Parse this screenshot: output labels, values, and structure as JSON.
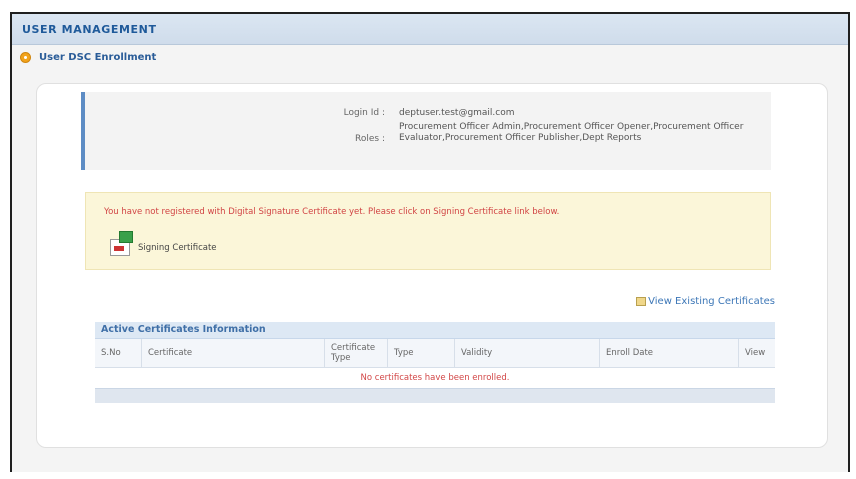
{
  "header": {
    "title": "USER MANAGEMENT"
  },
  "section": {
    "title": "User DSC Enrollment"
  },
  "user_info": {
    "login_label": "Login Id :",
    "login_value": "deptuser.test@gmail.com",
    "roles_label": "Roles :",
    "roles_value": "Procurement Officer Admin,Procurement Officer Opener,Procurement Officer Evaluator,Procurement Officer Publisher,Dept Reports"
  },
  "warning": {
    "message": "You have not registered with Digital Signature Certificate yet. Please click on Signing Certificate link below.",
    "signing_label": "Signing Certificate"
  },
  "view_existing": {
    "label": "View Existing Certificates"
  },
  "certificates_table": {
    "title": "Active Certificates Information",
    "columns": [
      "S.No",
      "Certificate",
      "Certificate Type",
      "Type",
      "Validity",
      "Enroll Date",
      "View"
    ],
    "empty_message": "No certificates have been enrolled."
  },
  "icons": [
    "section-bullet-icon",
    "signing-certificate-icon",
    "view-certificate-icon"
  ],
  "colors": {
    "header_bg": "#dbe6f2",
    "accent_blue": "#1f5a9a",
    "warning_bg": "#fbf6d9",
    "warning_text": "#d14444"
  }
}
